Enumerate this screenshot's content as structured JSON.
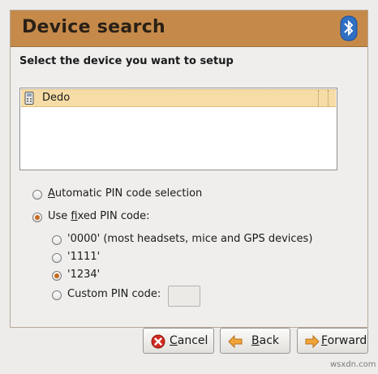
{
  "header": {
    "title": "Device search",
    "icon": "bluetooth-icon",
    "bg_color": "#c58a4a"
  },
  "prompt": "Select the device you want to setup",
  "devices": [
    {
      "name": "Dedo",
      "icon": "phone-icon"
    }
  ],
  "pin": {
    "auto": {
      "pre": "",
      "mnemonic": "A",
      "post": "utomatic PIN code selection",
      "checked": false
    },
    "fixed": {
      "pre": "Use ",
      "mnemonic": "f",
      "post": "ixed PIN code:",
      "checked": true
    },
    "options": [
      {
        "label": "'0000' (most headsets, mice and GPS devices)",
        "checked": false
      },
      {
        "label": "'1111'",
        "checked": false
      },
      {
        "label": "'1234'",
        "checked": true
      },
      {
        "label": "Custom PIN code:",
        "checked": false
      }
    ],
    "custom_value": ""
  },
  "buttons": {
    "cancel": {
      "pre": "",
      "mnemonic": "C",
      "post": "ancel",
      "icon": "cancel-icon"
    },
    "back": {
      "pre": "",
      "mnemonic": "B",
      "post": "ack",
      "icon": "back-arrow-icon"
    },
    "forward": {
      "pre": "",
      "mnemonic": "F",
      "post": "orward",
      "icon": "forward-arrow-icon"
    }
  },
  "watermark": "wsxdn.com"
}
